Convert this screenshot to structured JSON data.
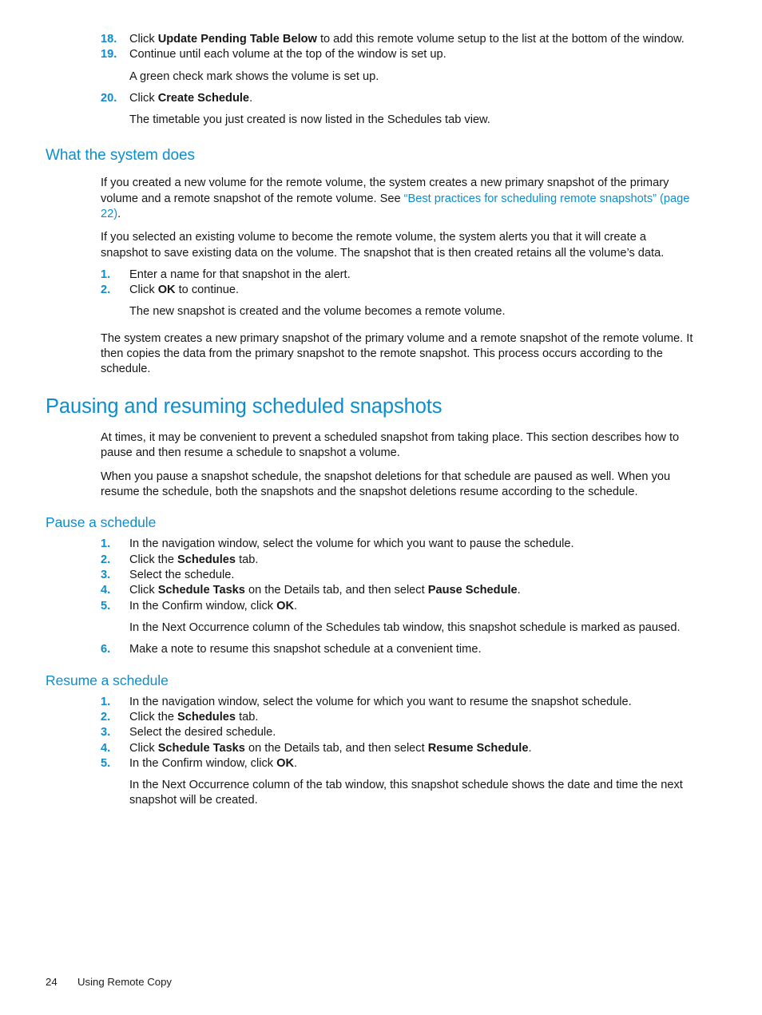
{
  "document": {
    "page_number": "24",
    "footer_title": "Using Remote Copy",
    "accent_color": "#0b8ed0"
  },
  "continued_steps": {
    "items": [
      {
        "num": "18.",
        "pre": "Click ",
        "bold": "Update Pending Table Below",
        "post": " to add this remote volume setup to the list at the bottom of the window."
      },
      {
        "num": "19.",
        "pre": "Continue until each volume at the top of the window is set up.",
        "bold": "",
        "post": ""
      },
      {
        "num": "20.",
        "pre": "Click ",
        "bold": "Create Schedule",
        "post": "."
      }
    ],
    "note_after_19": "A green check mark shows the volume is set up.",
    "note_after_20": "The timetable you just created is now listed in the Schedules tab view."
  },
  "what_the_system_does": {
    "heading": "What the system does",
    "para1_pre": "If you created a new volume for the remote volume, the system creates a new primary snapshot of the primary volume and a remote snapshot of the remote volume. See ",
    "para1_link": "“Best practices for scheduling remote snapshots” (page 22)",
    "para1_post": ".",
    "para2": "If you selected an existing volume to become the remote volume, the system alerts you that it will create a snapshot to save existing data on the volume. The snapshot that is then created retains all the volume’s data.",
    "steps": [
      {
        "num": "1.",
        "pre": "Enter a name for that snapshot in the alert.",
        "bold": "",
        "post": ""
      },
      {
        "num": "2.",
        "pre": "Click ",
        "bold": "OK",
        "post": " to continue."
      }
    ],
    "note_after_step2": "The new snapshot is created and the volume becomes a remote volume.",
    "para3": "The system creates a new primary snapshot of the primary volume and a remote snapshot of the remote volume. It then copies the data from the primary snapshot to the remote snapshot. This process occurs according to the schedule."
  },
  "pausing_resuming": {
    "heading": "Pausing and resuming scheduled snapshots",
    "para1": "At times, it may be convenient to prevent a scheduled snapshot from taking place. This section describes how to pause and then resume a schedule to snapshot a volume.",
    "para2": "When you pause a snapshot schedule, the snapshot deletions for that schedule are paused as well. When you resume the schedule, both the snapshots and the snapshot deletions resume according to the schedule."
  },
  "pause_a_schedule": {
    "heading": "Pause a schedule",
    "steps": [
      {
        "num": "1.",
        "pre": "In the navigation window, select the volume for which you want to pause the schedule.",
        "bold": "",
        "post": ""
      },
      {
        "num": "2.",
        "pre": "Click the ",
        "bold": "Schedules",
        "post": " tab."
      },
      {
        "num": "3.",
        "pre": "Select the schedule.",
        "bold": "",
        "post": ""
      },
      {
        "num": "4.",
        "pre": "Click ",
        "bold": "Schedule Tasks",
        "mid": " on the Details tab, and then select ",
        "bold2": "Pause Schedule",
        "post": "."
      },
      {
        "num": "5.",
        "pre": "In the Confirm window, click ",
        "bold": "OK",
        "post": "."
      },
      {
        "num": "6.",
        "pre": "Make a note to resume this snapshot schedule at a convenient time.",
        "bold": "",
        "post": ""
      }
    ],
    "note_after_step5": "In the Next Occurrence column of the Schedules tab window, this snapshot schedule is marked as paused."
  },
  "resume_a_schedule": {
    "heading": "Resume a schedule",
    "steps": [
      {
        "num": "1.",
        "pre": "In the navigation window, select the volume for which you want to resume the snapshot schedule.",
        "bold": "",
        "post": ""
      },
      {
        "num": "2.",
        "pre": "Click the ",
        "bold": "Schedules",
        "post": " tab."
      },
      {
        "num": "3.",
        "pre": "Select the desired schedule.",
        "bold": "",
        "post": ""
      },
      {
        "num": "4.",
        "pre": "Click ",
        "bold": "Schedule Tasks",
        "mid": " on the Details tab, and then select ",
        "bold2": "Resume Schedule",
        "post": "."
      },
      {
        "num": "5.",
        "pre": "In the Confirm window, click ",
        "bold": "OK",
        "post": "."
      }
    ],
    "note_after_step5": "In the Next Occurrence column of the tab window, this snapshot schedule shows the date and time the next snapshot will be created."
  }
}
